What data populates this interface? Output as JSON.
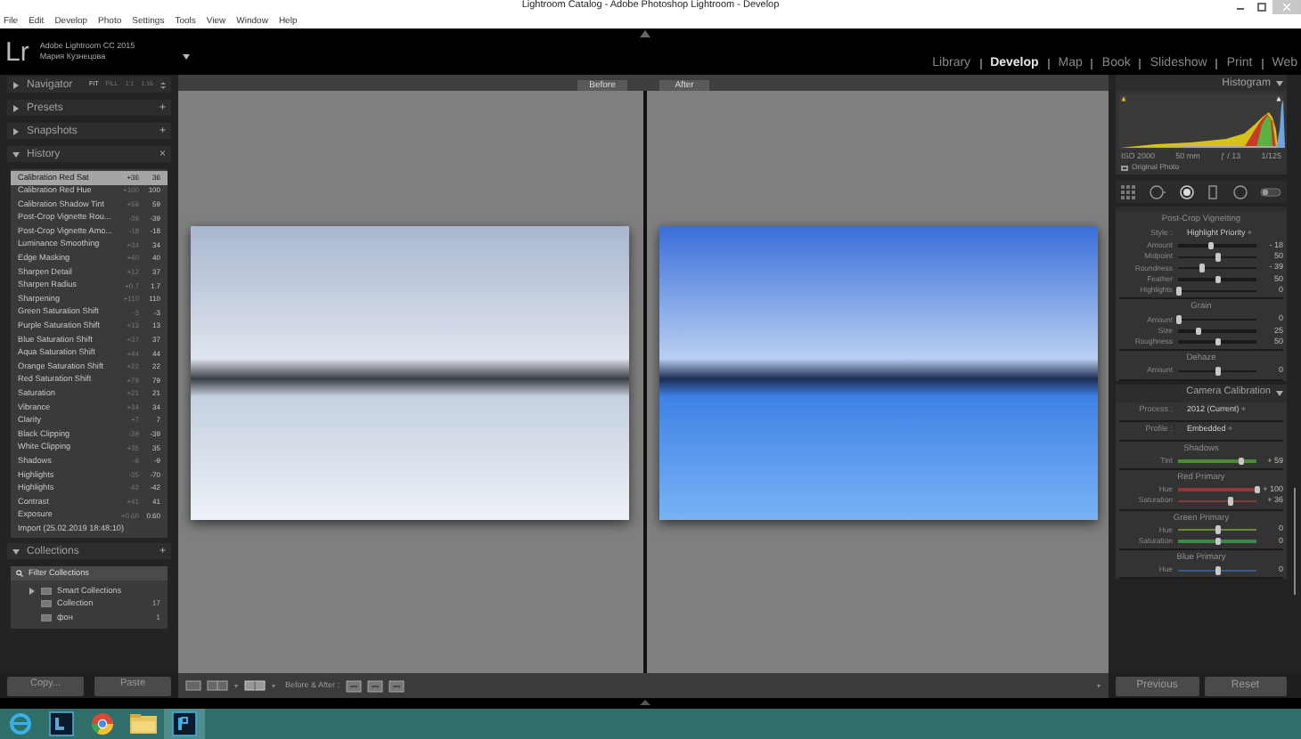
{
  "window": {
    "title": "Lightroom Catalog - Adobe Photoshop Lightroom - Develop"
  },
  "menu": [
    "File",
    "Edit",
    "Develop",
    "Photo",
    "Settings",
    "Tools",
    "View",
    "Window",
    "Help"
  ],
  "identity": {
    "logo": "Lr",
    "product": "Adobe Lightroom CC 2015",
    "user": "Мария Кузнецова"
  },
  "modules": [
    {
      "label": "Library",
      "selected": false
    },
    {
      "label": "Develop",
      "selected": true
    },
    {
      "label": "Map",
      "selected": false
    },
    {
      "label": "Book",
      "selected": false
    },
    {
      "label": "Slideshow",
      "selected": false
    },
    {
      "label": "Print",
      "selected": false
    },
    {
      "label": "Web",
      "selected": false
    }
  ],
  "left_panel": {
    "navigator": {
      "title": "Navigator",
      "zoom_options": [
        {
          "label": "FIT",
          "selected": true
        },
        {
          "label": "FILL",
          "selected": false
        },
        {
          "label": "1:1",
          "selected": false
        },
        {
          "label": "1:16",
          "selected": false
        }
      ]
    },
    "sections": [
      {
        "title": "Presets",
        "expanded": false,
        "action": "+"
      },
      {
        "title": "Snapshots",
        "expanded": false,
        "action": "+"
      }
    ],
    "history": {
      "title": "History",
      "expanded": true,
      "action": "×",
      "items": [
        {
          "label": "Calibration Red Sat",
          "delta": "+36",
          "value": "36",
          "selected": true
        },
        {
          "label": "Calibration Red Hue",
          "delta": "+100",
          "value": "100",
          "selected": false
        },
        {
          "label": "Calibration Shadow Tint",
          "delta": "+59",
          "value": "59",
          "selected": false
        },
        {
          "label": "Post-Crop Vignette Rou...",
          "delta": "-39",
          "value": "-39",
          "selected": false
        },
        {
          "label": "Post-Crop Vignette Amo...",
          "delta": "-18",
          "value": "-18",
          "selected": false
        },
        {
          "label": "Luminance Smoothing",
          "delta": "+34",
          "value": "34",
          "selected": false
        },
        {
          "label": "Edge Masking",
          "delta": "+40",
          "value": "40",
          "selected": false
        },
        {
          "label": "Sharpen Detail",
          "delta": "+12",
          "value": "37",
          "selected": false
        },
        {
          "label": "Sharpen Radius",
          "delta": "+0.7",
          "value": "1.7",
          "selected": false
        },
        {
          "label": "Sharpening",
          "delta": "+110",
          "value": "110",
          "selected": false
        },
        {
          "label": "Green Saturation Shift",
          "delta": "-3",
          "value": "-3",
          "selected": false
        },
        {
          "label": "Purple Saturation Shift",
          "delta": "+13",
          "value": "13",
          "selected": false
        },
        {
          "label": "Blue Saturation Shift",
          "delta": "+37",
          "value": "37",
          "selected": false
        },
        {
          "label": "Aqua Saturation Shift",
          "delta": "+44",
          "value": "44",
          "selected": false
        },
        {
          "label": "Orange Saturation Shift",
          "delta": "+22",
          "value": "22",
          "selected": false
        },
        {
          "label": "Red Saturation Shift",
          "delta": "+79",
          "value": "79",
          "selected": false
        },
        {
          "label": "Saturation",
          "delta": "+21",
          "value": "21",
          "selected": false
        },
        {
          "label": "Vibrance",
          "delta": "+34",
          "value": "34",
          "selected": false
        },
        {
          "label": "Clarity",
          "delta": "+7",
          "value": "7",
          "selected": false
        },
        {
          "label": "Black Clipping",
          "delta": "-39",
          "value": "-39",
          "selected": false
        },
        {
          "label": "White Clipping",
          "delta": "+35",
          "value": "35",
          "selected": false
        },
        {
          "label": "Shadows",
          "delta": "-9",
          "value": "-9",
          "selected": false
        },
        {
          "label": "Highlights",
          "delta": "-35",
          "value": "-70",
          "selected": false
        },
        {
          "label": "Highlights",
          "delta": "-42",
          "value": "-42",
          "selected": false
        },
        {
          "label": "Contrast",
          "delta": "+41",
          "value": "41",
          "selected": false
        },
        {
          "label": "Exposure",
          "delta": "+0.60",
          "value": "0.60",
          "selected": false
        },
        {
          "label": "Import (25.02.2019 18:48:10)",
          "selected": false
        }
      ]
    },
    "collections": {
      "title": "Collections",
      "expanded": true,
      "action": "+",
      "items": [
        {
          "kind": "filter",
          "label": "Filter Collections"
        },
        {
          "kind": "set",
          "label": "Smart Collections",
          "expanded": false
        },
        {
          "kind": "collection",
          "label": "Collection",
          "count": "17"
        },
        {
          "kind": "collection",
          "label": "фон",
          "count": "1"
        }
      ]
    },
    "buttons": [
      "Copy...",
      "Paste"
    ]
  },
  "view": {
    "labels": [
      "Before",
      "After"
    ],
    "photos": [
      {
        "edited": false
      },
      {
        "edited": true
      }
    ]
  },
  "toolbar": {
    "before_after_label": "Before & After :"
  },
  "right_panel": {
    "histogram": {
      "title": "Histogram",
      "info": [
        "ISO 2000",
        "50 mm",
        "ƒ / 13",
        "1/125"
      ],
      "original_photo": {
        "label": "Original Photo",
        "checked": false
      }
    },
    "effects": {
      "groups": [
        {
          "title": "Post-Crop Vignetting",
          "rows": [
            {
              "kind": "select",
              "label": "Style :",
              "value": "Highlight Priority ÷"
            },
            {
              "kind": "slider",
              "label": "Amount",
              "value": "- 18",
              "level": 0.41
            },
            {
              "kind": "slider",
              "label": "Midpoint",
              "value": "50",
              "level": 0.5
            },
            {
              "kind": "slider",
              "label": "Roundness",
              "value": "- 39",
              "level": 0.3
            },
            {
              "kind": "slider",
              "label": "Feather",
              "value": "50",
              "level": 0.5
            },
            {
              "kind": "slider",
              "label": "Highlights",
              "value": "0",
              "level": 0.0
            }
          ]
        },
        {
          "title": "Grain",
          "rows": [
            {
              "kind": "slider",
              "label": "Amount",
              "value": "0",
              "level": 0.0
            },
            {
              "kind": "slider",
              "label": "Size",
              "value": "25",
              "level": 0.25
            },
            {
              "kind": "slider",
              "label": "Roughness",
              "value": "50",
              "level": 0.5
            }
          ]
        },
        {
          "title": "Dehaze",
          "rows": [
            {
              "kind": "slider",
              "label": "Amount",
              "value": "0",
              "level": 0.5
            }
          ]
        }
      ]
    },
    "calibration": {
      "title": "Camera Calibration",
      "groups": [
        {
          "rows": [
            {
              "kind": "select",
              "label": "Process :",
              "value": "2012 (Current) ÷"
            }
          ]
        },
        {
          "rows": [
            {
              "kind": "select",
              "label": "Profile :",
              "value": "Embedded ÷"
            }
          ]
        },
        {
          "title": "Shadows",
          "rows": [
            {
              "kind": "slider",
              "label": "Tint",
              "value": "+ 59",
              "level": 0.8,
              "color": "#4f8a3a"
            }
          ]
        },
        {
          "title": "Red Primary",
          "rows": [
            {
              "kind": "slider",
              "label": "Hue",
              "value": "+ 100",
              "level": 1.0,
              "color": "#8a3a3a"
            },
            {
              "kind": "slider",
              "label": "Saturation",
              "value": "+ 36",
              "level": 0.68,
              "color": "#8a3a3a"
            }
          ]
        },
        {
          "title": "Green Primary",
          "rows": [
            {
              "kind": "slider",
              "label": "Hue",
              "value": "0",
              "level": 0.5,
              "color": "#6a8a3a"
            },
            {
              "kind": "slider",
              "label": "Saturation",
              "value": "0",
              "level": 0.5,
              "color": "#3a8a4a"
            }
          ]
        },
        {
          "title": "Blue Primary",
          "rows": [
            {
              "kind": "slider",
              "label": "Hue",
              "value": "0",
              "level": 0.5,
              "color": "#3a5a8a"
            }
          ]
        }
      ]
    },
    "buttons": [
      "Previous",
      "Reset"
    ]
  }
}
